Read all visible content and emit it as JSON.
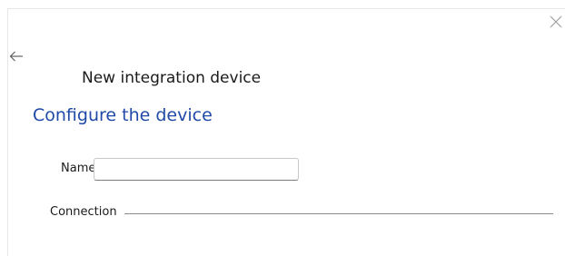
{
  "dialog": {
    "title": "New integration device",
    "heading": "Configure the device",
    "close_icon": "close-icon",
    "back_icon": "back-arrow-icon"
  },
  "form": {
    "name_label": "Name",
    "name_value": "",
    "connection_label": "Connection"
  },
  "colors": {
    "heading": "#1f4aa8",
    "text": "#1a1a1a",
    "rule": "#8a8a8a"
  }
}
